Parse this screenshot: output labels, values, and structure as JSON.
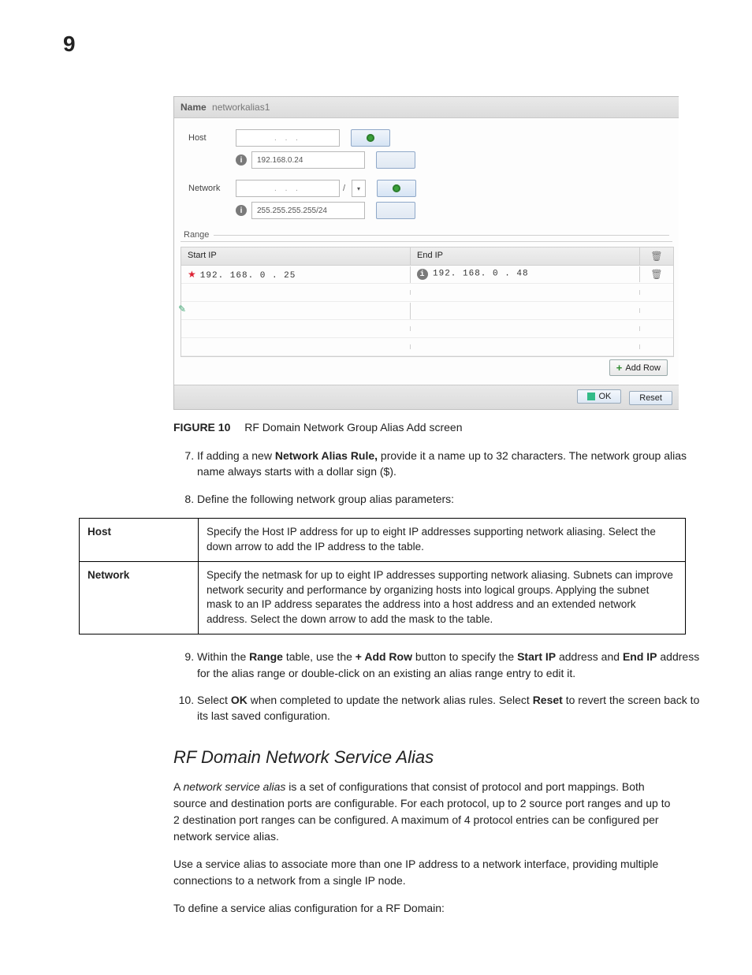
{
  "page_number": "9",
  "panel": {
    "name_label": "Name",
    "name_value": "networkalias1",
    "host_label": "Host",
    "host_dots": ".   .   .",
    "host_value": "192.168.0.24",
    "network_label": "Network",
    "network_dots": ".   .   .",
    "network_slash": "/",
    "network_value": "255.255.255.255/24",
    "range_label": "Range",
    "range_headers": {
      "start": "Start IP",
      "end": "End IP"
    },
    "range_rows": [
      {
        "start": "192. 168.  0  . 25",
        "end": "192. 168.  0  . 48"
      }
    ],
    "add_row_label": "Add Row",
    "ok_label": "OK",
    "reset_label": "Reset"
  },
  "figure": {
    "label": "FIGURE 10",
    "caption": "RF Domain Network Group Alias Add screen"
  },
  "steps": {
    "s7a": "If adding a new ",
    "s7b": "Network Alias Rule,",
    "s7c": " provide it a name up to 32 characters. The network group alias name always starts with a dollar sign ($).",
    "s8": "Define the following network group alias parameters:",
    "s9a": "Within the ",
    "s9b": "Range",
    "s9c": " table, use the ",
    "s9d": "+ Add Row",
    "s9e": " button to specify the ",
    "s9f": "Start IP",
    "s9g": " address and ",
    "s9h": "End IP",
    "s9i": " address for the alias range or double-click on an existing an alias range entry to edit it.",
    "s10a": "Select ",
    "s10b": "OK",
    "s10c": " when completed to update the network alias rules. Select ",
    "s10d": "Reset",
    "s10e": " to revert the screen back to its last saved configuration."
  },
  "def_table": {
    "host_label": "Host",
    "host_text": "Specify the Host IP address for up to eight IP addresses supporting network aliasing. Select the down arrow to add the IP address to the table.",
    "network_label": "Network",
    "network_text": "Specify the netmask for up to eight IP addresses supporting network aliasing. Subnets can improve network security and performance by organizing hosts into logical groups. Applying the subnet mask to an IP address separates the address into a host address and an extended network address. Select the down arrow to add the mask to the table."
  },
  "section_heading": "RF Domain Network Service Alias",
  "para1a": "A ",
  "para1b": "network service alias",
  "para1c": " is a set of configurations that consist of protocol and port mappings. Both source and destination ports are configurable. For each protocol, up to 2 source port ranges and up to 2 destination port ranges can be configured. A maximum of 4 protocol entries can be configured per network service alias.",
  "para2": "Use a service alias to associate more than one IP address to a network interface, providing multiple connections to a network from a single IP node.",
  "para3": "To define a service alias configuration for a RF Domain:"
}
